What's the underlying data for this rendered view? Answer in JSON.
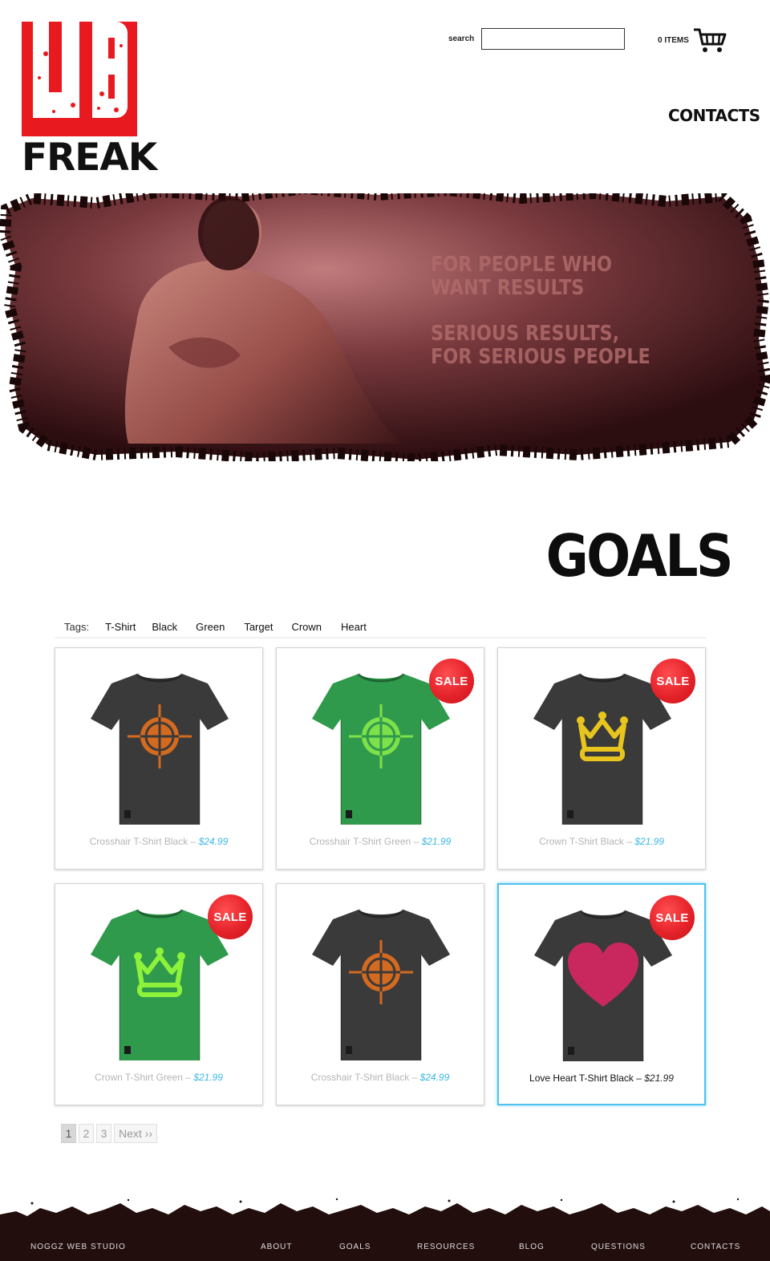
{
  "logo": {
    "top_text": "UB",
    "bottom_text": "FREAK"
  },
  "header": {
    "search_label": "search",
    "search_value": "",
    "cart_count": "0 ITEMS",
    "contacts_link": "CONTACTS"
  },
  "hero": {
    "line1": "FOR PEOPLE WHO",
    "line2": "WANT RESULTS",
    "line3": "SERIOUS RESULTS,",
    "line4": "FOR SERIOUS PEOPLE"
  },
  "page_title": "GOALS",
  "tags": {
    "label": "Tags:",
    "items": [
      "T-Shirt",
      "Black",
      "Green",
      "Target",
      "Crown",
      "Heart"
    ]
  },
  "products": [
    {
      "name": "Crosshair T-Shirt Black",
      "sep": " – ",
      "price": "$24.99",
      "sale": false,
      "shirt_color": "#3a3a3a",
      "graphic": "crosshair",
      "graphic_color": "#d46a1f"
    },
    {
      "name": "Crosshair T-Shirt Green",
      "sep": " – ",
      "price": "$21.99",
      "sale": true,
      "sale_label": "SALE",
      "shirt_color": "#2f9a4c",
      "graphic": "crosshair",
      "graphic_color": "#7ee04a"
    },
    {
      "name": "Crown T-Shirt Black",
      "sep": " – ",
      "price": "$21.99",
      "sale": true,
      "sale_label": "SALE",
      "shirt_color": "#3a3a3a",
      "graphic": "crown",
      "graphic_color": "#e8c51e"
    },
    {
      "name": "Crown T-Shirt Green",
      "sep": " – ",
      "price": "$21.99",
      "sale": true,
      "sale_label": "SALE",
      "shirt_color": "#2f9a4c",
      "graphic": "crown",
      "graphic_color": "#8cf23a"
    },
    {
      "name": "Crosshair T-Shirt Black",
      "sep": " – ",
      "price": "$24.99",
      "sale": false,
      "shirt_color": "#3a3a3a",
      "graphic": "crosshair",
      "graphic_color": "#d46a1f"
    },
    {
      "name": "Love Heart T-Shirt Black",
      "sep": " – ",
      "price": "$21.99",
      "sale": true,
      "sale_label": "SALE",
      "shirt_color": "#3a3a3a",
      "graphic": "heart",
      "graphic_color": "#c8285e",
      "hovered": true
    }
  ],
  "pagination": {
    "pages": [
      "1",
      "2",
      "3"
    ],
    "current": "1",
    "next_label": "Next ››"
  },
  "footer": {
    "brand": "NOGGZ WEB STUDIO",
    "nav": [
      "ABOUT",
      "GOALS",
      "RESOURCES",
      "BLOG",
      "QUESTIONS",
      "CONTACTS"
    ]
  },
  "colors": {
    "brand_red": "#e8191f",
    "price_blue": "#38b6e8",
    "footer_bg": "#230e0e",
    "hover_border": "#4fc2ee"
  }
}
